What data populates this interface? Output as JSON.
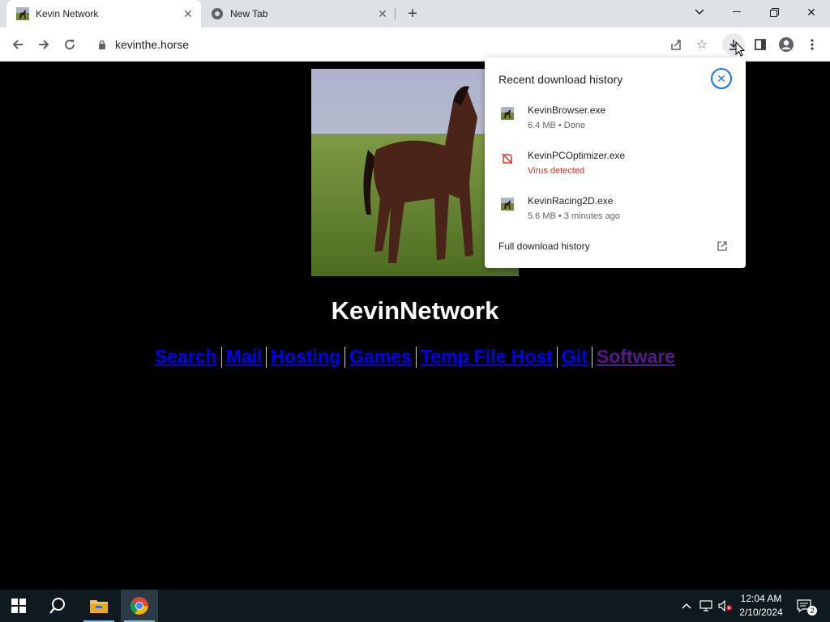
{
  "browser": {
    "tabs": [
      {
        "title": "Kevin Network",
        "active": true
      },
      {
        "title": "New Tab",
        "active": false
      }
    ],
    "url": "kevinthe.horse"
  },
  "page": {
    "title": "KevinNetwork",
    "nav_links": [
      {
        "label": "Search",
        "visited": false
      },
      {
        "label": "Mail",
        "visited": false
      },
      {
        "label": "Hosting",
        "visited": false
      },
      {
        "label": "Games",
        "visited": false
      },
      {
        "label": "Temp File Host",
        "visited": false
      },
      {
        "label": "Git",
        "visited": false
      },
      {
        "label": "Software",
        "visited": true
      }
    ]
  },
  "downloads": {
    "heading": "Recent download history",
    "items": [
      {
        "name": "KevinBrowser.exe",
        "status": "6.4 MB • Done",
        "icon": "file-icon",
        "danger": false
      },
      {
        "name": "KevinPCOptimizer.exe",
        "status": "Virus detected",
        "icon": "blocked-download-icon",
        "danger": true
      },
      {
        "name": "KevinRacing2D.exe",
        "status": "5.6 MB • 3 minutes ago",
        "icon": "file-icon",
        "danger": false
      }
    ],
    "full_history_label": "Full download history"
  },
  "taskbar": {
    "time": "12:04 AM",
    "date": "2/10/2024",
    "notifications": "2"
  },
  "colors": {
    "link": "#0000ee",
    "visited_link": "#551a8b",
    "danger": "#d93025",
    "accent": "#1a73e8"
  }
}
